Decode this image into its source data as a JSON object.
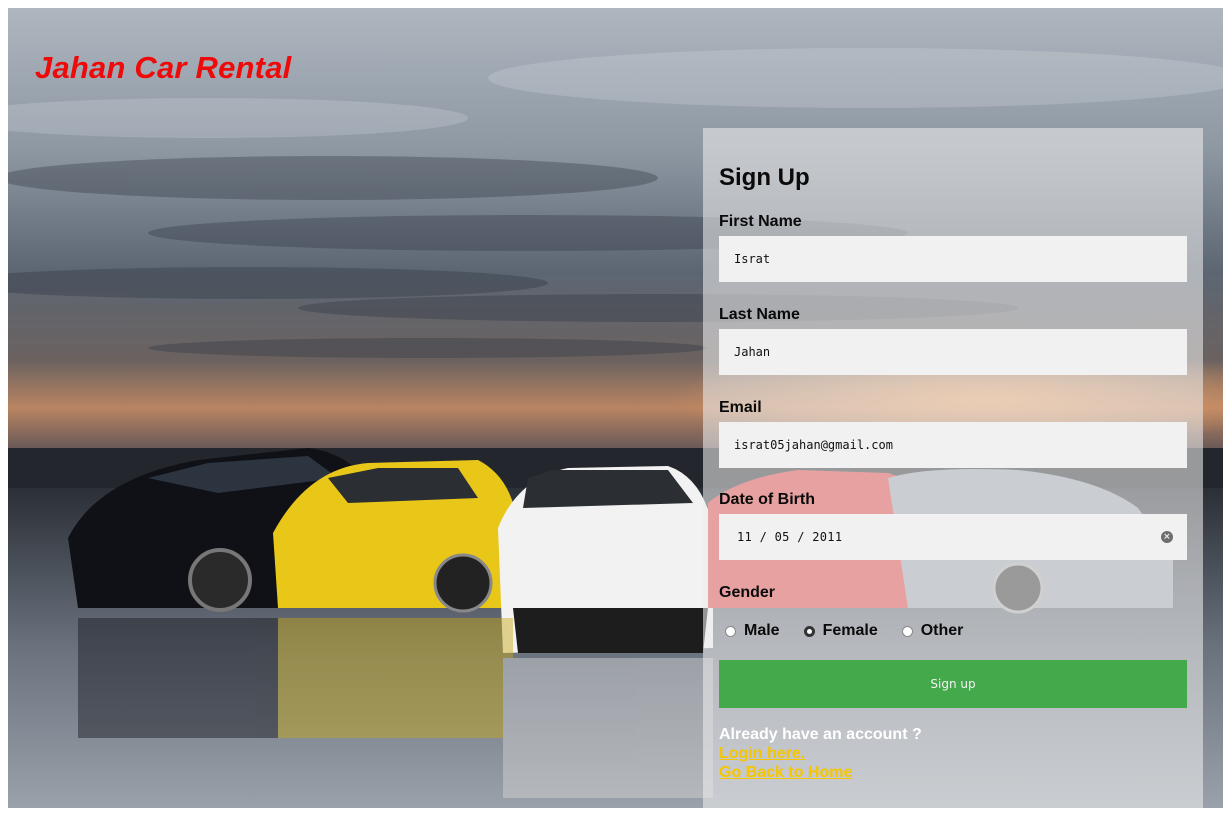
{
  "brand": {
    "title": "Jahan Car Rental",
    "color": "#ee0a0a"
  },
  "form": {
    "heading": "Sign Up",
    "first_name": {
      "label": "First Name",
      "value": "Israt"
    },
    "last_name": {
      "label": "Last Name",
      "value": "Jahan"
    },
    "email": {
      "label": "Email",
      "value": "israt05jahan@gmail.com"
    },
    "dob": {
      "label": "Date of Birth",
      "value": "11 / 05 / 2011"
    },
    "gender": {
      "label": "Gender",
      "options": [
        "Male",
        "Female",
        "Other"
      ],
      "selected": "Female"
    },
    "submit_label": "Sign up",
    "already_text": "Already have an account ?",
    "login_link": "Login here.",
    "home_link": "Go Back to Home"
  },
  "colors": {
    "submit_bg": "#43a94b",
    "link": "#f5c600"
  }
}
